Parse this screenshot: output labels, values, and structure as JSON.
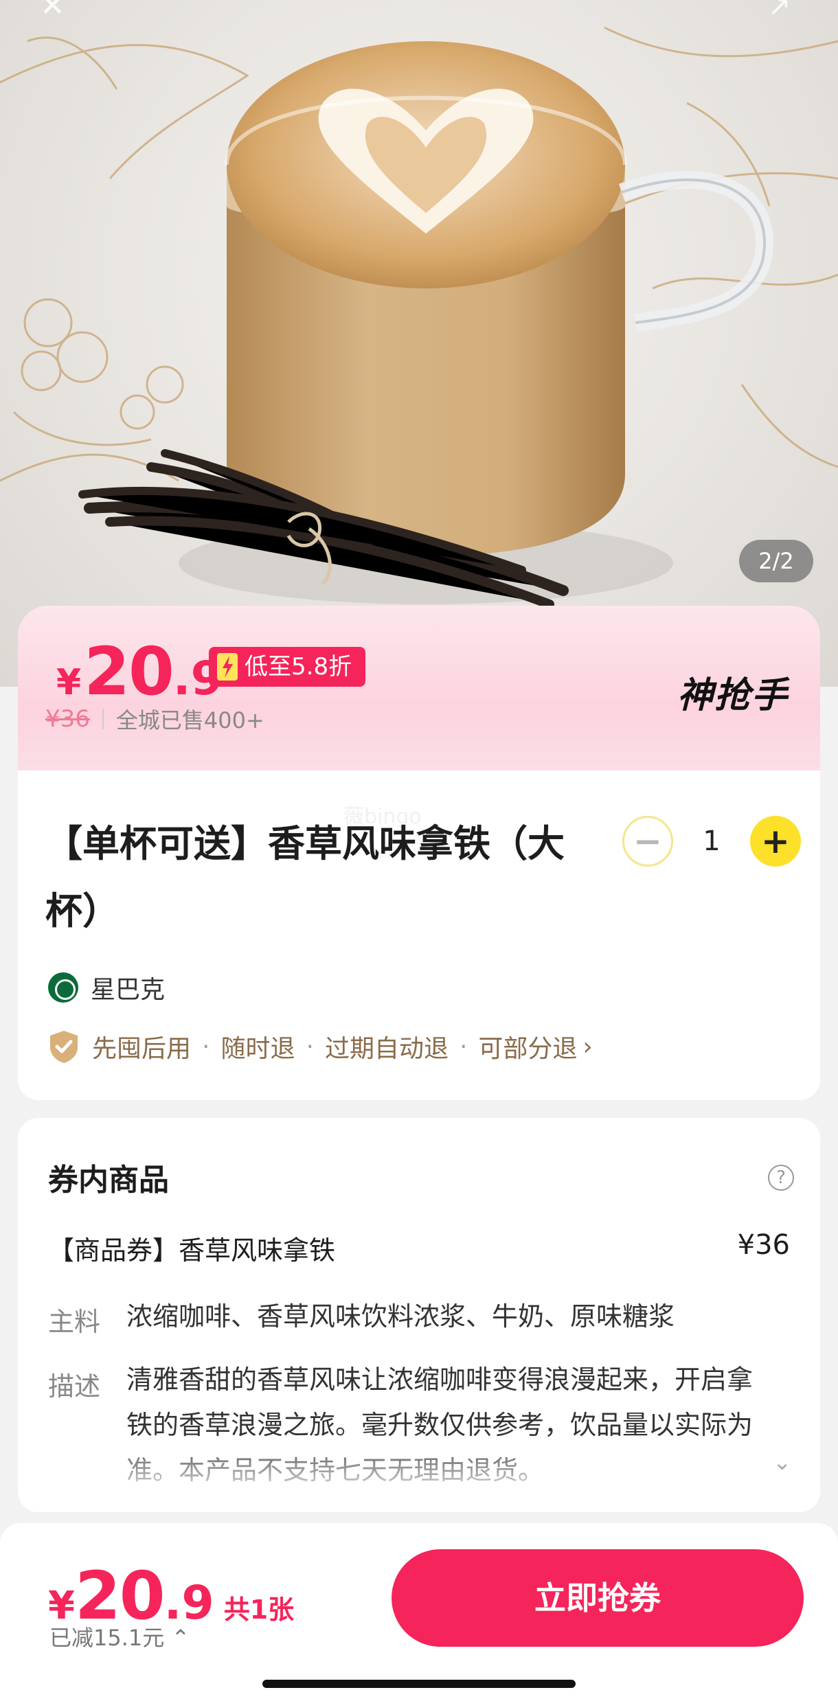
{
  "hero": {
    "page_indicator": "2/2",
    "close_icon": "close-icon",
    "share_icon": "share-icon"
  },
  "price_banner": {
    "currency": "¥",
    "price_int": "20",
    "price_dec": ".9",
    "discount": "低至5.8折",
    "original_price": "¥36",
    "sold": "全城已售400+",
    "brand": "神抢手",
    "accent_color": "#f5245a"
  },
  "product": {
    "watermark": "薇bingo",
    "title": "【单杯可送】香草风味拿铁（大杯）",
    "quantity": "1",
    "store": "星巴克",
    "policies": [
      "先囤后用",
      "随时退",
      "过期自动退",
      "可部分退"
    ]
  },
  "voucher": {
    "section_title": "券内商品",
    "item_name": "【商品券】香草风味拿铁",
    "item_price": "¥36",
    "ingredients_label": "主料",
    "ingredients": "浓缩咖啡、香草风味饮料浓浆、牛奶、原味糖浆",
    "desc_label": "描述",
    "desc": "清雅香甜的香草风味让浓缩咖啡变得浪漫起来，开启拿铁的香草浪漫之旅。毫升数仅供参考，饮品量以实际为准。本产品不支持七天无理由退货。"
  },
  "bottom": {
    "currency": "¥",
    "price_int": "20",
    "price_dec": ".9",
    "count": "共1张",
    "saved": "已减15.1元",
    "buy_label": "立即抢券"
  }
}
